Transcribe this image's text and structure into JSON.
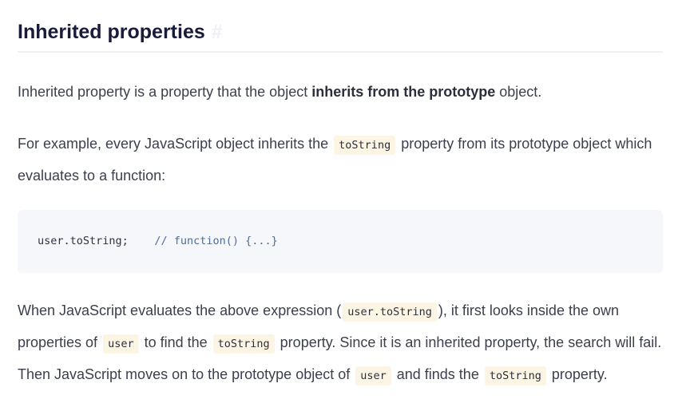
{
  "heading": {
    "title": "Inherited properties",
    "anchor": "#"
  },
  "paragraph1": {
    "before": "Inherited property is a property that the object ",
    "bold": "inherits from the prototype",
    "after": " object."
  },
  "paragraph2": {
    "before": "For example, every JavaScript object inherits the ",
    "code": "toString",
    "after": " property from its prototype object which evaluates to a function:"
  },
  "code_block": {
    "statement": "user.toString;",
    "spacer": "    ",
    "comment": "// function() {...}"
  },
  "paragraph3": {
    "t1": "When JavaScript evaluates the above expression (",
    "c1": "user.toString",
    "t2": "), it first looks inside the own properties of ",
    "c2": "user",
    "t3": " to find the ",
    "c3": "toString",
    "t4": " property. Since it is an inherited property, the search will fail. Then JavaScript moves on to the prototype object of ",
    "c4": "user",
    "t5": " and finds the ",
    "c5": "toString",
    "t6": " property."
  },
  "colors": {
    "heading": "#181b3a",
    "text": "#3b3f4e",
    "inline_code_bg": "#fdf5e4",
    "code_block_bg": "#f5f7fa",
    "comment": "#4f6c9a"
  }
}
